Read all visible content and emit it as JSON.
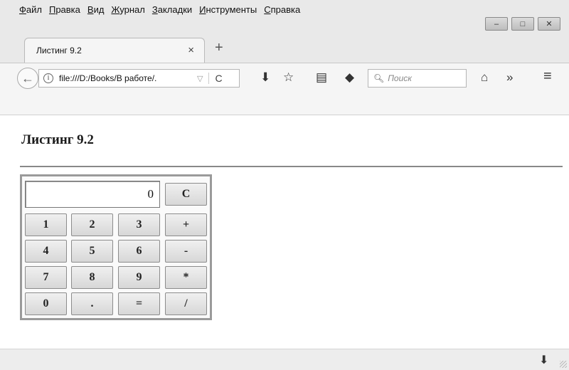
{
  "menubar": {
    "items": [
      {
        "label": "Файл",
        "accel": "Ф"
      },
      {
        "label": "Правка",
        "accel": "П"
      },
      {
        "label": "Вид",
        "accel": "В"
      },
      {
        "label": "Журнал",
        "accel": "Ж"
      },
      {
        "label": "Закладки",
        "accel": "З"
      },
      {
        "label": "Инструменты",
        "accel": "И"
      },
      {
        "label": "Справка",
        "accel": "С"
      }
    ]
  },
  "window_controls": {
    "minimize": "–",
    "maximize": "□",
    "close": "✕"
  },
  "tab": {
    "title": "Листинг 9.2",
    "close": "×",
    "new_tab": "+"
  },
  "navbar": {
    "back": "←",
    "url": "file:///D:/Books/В работе/.",
    "dropdown": "▽",
    "reload": "C",
    "search_placeholder": "Поиск",
    "download": "⬇",
    "bookmark_star": "☆",
    "library": "▤",
    "pocket": "◆",
    "home": "⌂",
    "overflow": "»",
    "menu": "≡"
  },
  "page": {
    "heading": "Листинг 9.2"
  },
  "calculator": {
    "display": "0",
    "clear": "C",
    "rows": [
      [
        "1",
        "2",
        "3",
        "+"
      ],
      [
        "4",
        "5",
        "6",
        "-"
      ],
      [
        "7",
        "8",
        "9",
        "*"
      ],
      [
        "0",
        ".",
        "=",
        "/"
      ]
    ]
  },
  "statusbar": {
    "download": "⬇"
  },
  "icons": {
    "back": "back-arrow-icon",
    "info": "info-icon",
    "reload": "reload-icon",
    "search": "search-icon",
    "download": "download-icon",
    "star": "star-icon",
    "library": "library-icon",
    "pocket": "pocket-icon",
    "home": "home-icon",
    "overflow": "overflow-icon",
    "menu": "hamburger-menu-icon"
  }
}
